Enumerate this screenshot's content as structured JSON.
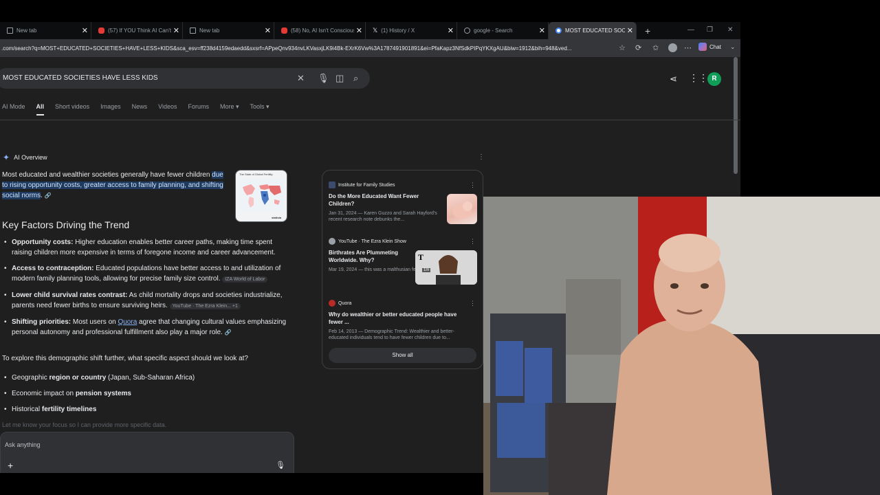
{
  "tabs": [
    {
      "label": "New tab",
      "favicon": "doc-icon"
    },
    {
      "label": "(57) If YOU Think AI Can't Re",
      "favicon": "youtube-icon"
    },
    {
      "label": "New tab",
      "favicon": "doc-icon"
    },
    {
      "label": "(58) No, AI Isn't Conscious: ",
      "favicon": "youtube-icon"
    },
    {
      "label": "(1) History / X",
      "favicon": "x-icon"
    },
    {
      "label": "google - Search",
      "favicon": "google-icon"
    },
    {
      "label": "MOST EDUCATED SOCIETIES",
      "favicon": "google-icon",
      "active": true
    }
  ],
  "address": {
    "url": ".com/search?q=MOST+EDUCATED+SOCIETIES+HAVE+LESS+KIDS&sca_esv=ff238d4159edaedd&sxsrf=APpeQnv934nvLKVasxjLK9i4Bk-EXrK6Vw%3A1787491901891&ei=PfaKapz3NfSdkPIPqYKXgAU&biw=1912&bih=948&ved...",
    "chat_label": "Chat"
  },
  "search": {
    "query": "MOST EDUCATED SOCIETIES HAVE LESS KIDS",
    "avatar_letter": "R"
  },
  "nav": {
    "tabs": [
      "AI Mode",
      "All",
      "Short videos",
      "Images",
      "News",
      "Videos",
      "Forums",
      "More",
      "Tools"
    ],
    "active": "All"
  },
  "ai_overview": {
    "header": "AI Overview",
    "intro_plain": "Most educated and wealthier societies generally have fewer children ",
    "intro_highlight": "due to rising opportunity costs, greater access to family planning, and shifting social norms",
    "intro_end": ".",
    "thumbnail_title": "The State of Global Fertility",
    "thumbnail_footer": "statista",
    "key_factors_heading": "Key Factors Driving the Trend",
    "factors": [
      {
        "bold": "Opportunity costs:",
        "text": " Higher education enables better career paths, making time spent raising children more expensive in terms of foregone income and career advancement.",
        "source": ""
      },
      {
        "bold": "Access to contraception:",
        "text": " Educated populations have better access to and utilization of modern family planning tools, allowing for precise family size control.",
        "source": "IZA World of Labor"
      },
      {
        "bold": "Lower child survival rates contrast:",
        "text": " As child mortality drops and societies industrialize, parents need fewer births to ensure surviving heirs.",
        "source": "YouTube · The Ezra Klein... +1"
      },
      {
        "bold": "Shifting priorities:",
        "text_before": " Most users on ",
        "link": "Quora",
        "text": " agree that changing cultural values emphasizing personal autonomy and professional fulfillment also play a major role.",
        "source": ""
      }
    ],
    "explore": "To explore this demographic shift further, what specific aspect should we look at?",
    "options": [
      {
        "before": "Geographic ",
        "bold": "region or country",
        "after": " (Japan, Sub-Saharan Africa)"
      },
      {
        "before": "Economic impact on ",
        "bold": "pension systems",
        "after": ""
      },
      {
        "before": "Historical ",
        "bold": "fertility timelines",
        "after": ""
      }
    ],
    "let_me_know": "Let me know your focus so I can provide more specific data."
  },
  "ask": {
    "placeholder": "Ask anything"
  },
  "sources": [
    {
      "site": "Institute for Family Studies",
      "title": "Do the More Educated Want Fewer Children?",
      "snippet": "Jan 31, 2024 — Karen Guzzo and Sarah Hayford's recent research note debunks the..."
    },
    {
      "site": "YouTube · The Ezra Klein Show",
      "title": "Birthrates Are Plummeting Worldwide. Why?",
      "snippet": "Mar 19, 2024 — this was a malthusian fear in the 18th...",
      "duration": "1m"
    },
    {
      "site": "Quora",
      "title": "Why do wealthier or better educated people have fewer ...",
      "snippet": "Feb 14, 2013 — Demographic Trend: Wealthier and better-educated individuals tend to have fewer children due to..."
    }
  ],
  "show_all": "Show all"
}
